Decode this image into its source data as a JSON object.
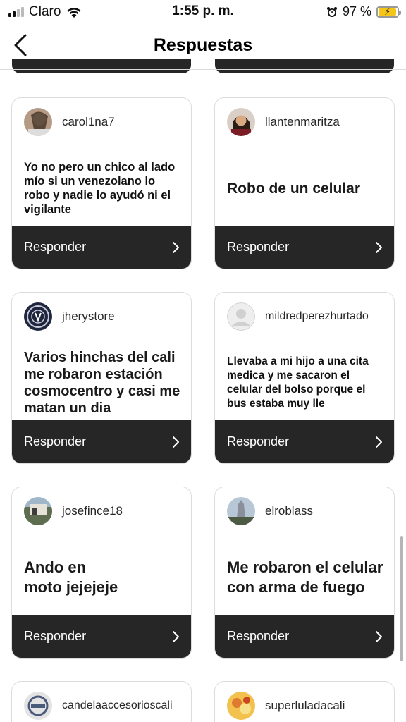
{
  "status_bar": {
    "carrier": "Claro",
    "time": "1:55 p. m.",
    "battery_percent": "97 %",
    "battery_level": 0.97,
    "icons": [
      "signal-icon",
      "wifi-icon",
      "alarm-icon",
      "battery-icon"
    ]
  },
  "nav": {
    "title": "Respuestas",
    "back_icon": "chevron-left-icon"
  },
  "reply_label": "Responder",
  "cards": [
    {
      "username": "carol1na7",
      "text": "Yo no pero un chico al lado mío si un venezolano lo robo y nadie lo ayudó ni el vigilante"
    },
    {
      "username": "llantenmaritza",
      "text": "Robo de un celular"
    },
    {
      "username": "jherystore",
      "text": "Varios hinchas del cali me robaron estación cosmocentro y casi me matan un dia"
    },
    {
      "username": "mildredperezhurtado",
      "text": "Llevaba a mi hijo a una cita medica y me sacaron el celular del bolso porque el bus estaba muy lle"
    },
    {
      "username": "josefince18",
      "text": "Ando en moto jejejeje"
    },
    {
      "username": "elroblass",
      "text": "Me robaron el celular con arma de fuego"
    },
    {
      "username": "candelaaccesorioscali",
      "text": ""
    },
    {
      "username": "superluladacali",
      "text": ""
    }
  ],
  "colors": {
    "card_footer": "#262626",
    "border": "#dcdcdc",
    "battery_fill": "#f5c518"
  }
}
